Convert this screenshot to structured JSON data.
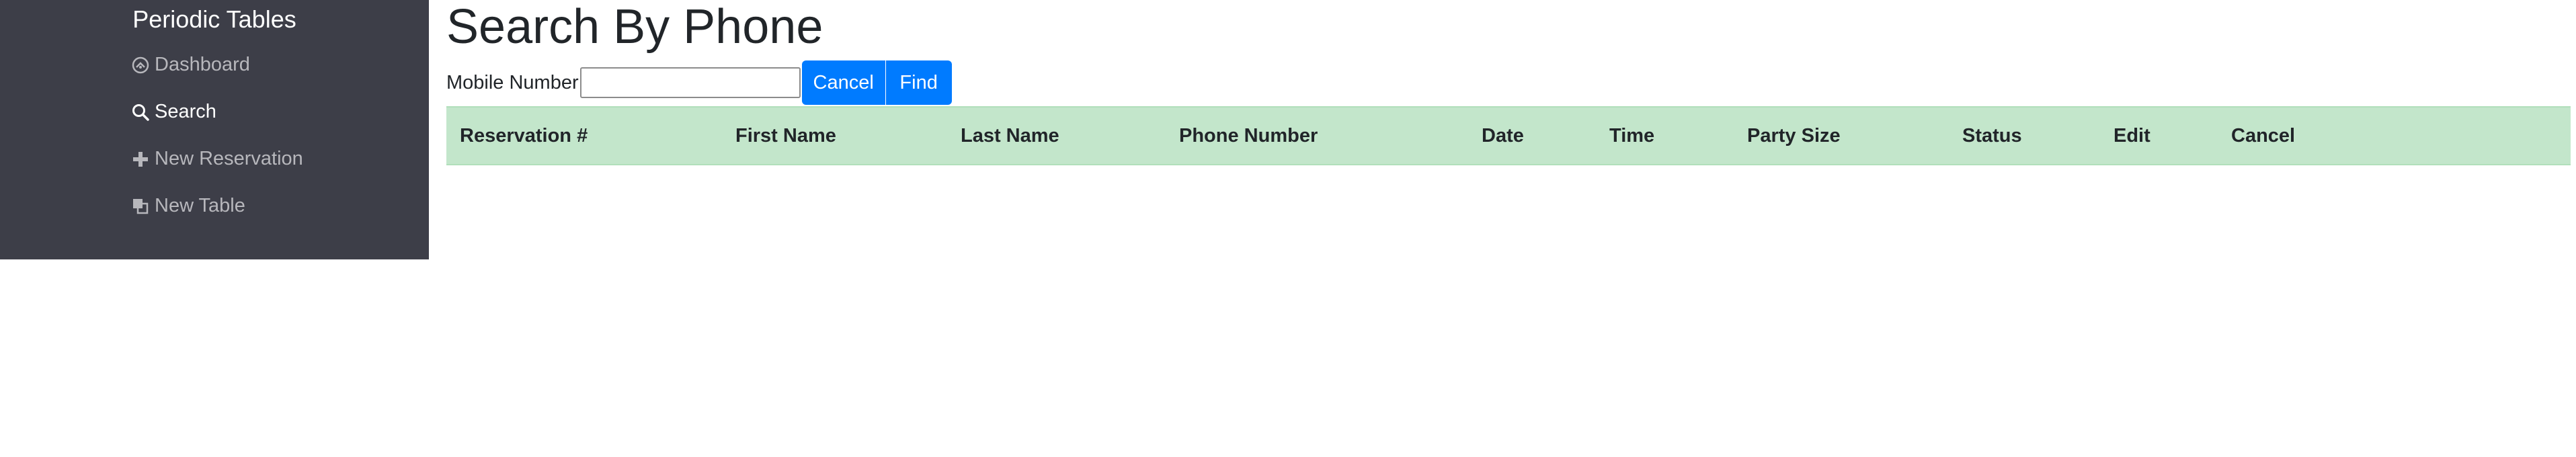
{
  "sidebar": {
    "brand": "Periodic Tables",
    "items": [
      {
        "label": "Dashboard",
        "icon": "dashboard-icon",
        "active": false
      },
      {
        "label": "Search",
        "icon": "search-icon",
        "active": true
      },
      {
        "label": "New Reservation",
        "icon": "plus-icon",
        "active": false
      },
      {
        "label": "New Table",
        "icon": "table-icon",
        "active": false
      }
    ]
  },
  "main": {
    "title": "Search By Phone",
    "form": {
      "label": "Mobile Number",
      "input_value": "",
      "placeholder": "",
      "cancel_label": "Cancel",
      "find_label": "Find"
    },
    "table": {
      "columns": [
        "Reservation #",
        "First Name",
        "Last Name",
        "Phone Number",
        "Date",
        "Time",
        "Party Size",
        "Status",
        "Edit",
        "Cancel"
      ],
      "rows": []
    }
  },
  "colors": {
    "sidebar_bg": "#3d3e48",
    "primary": "#007bff",
    "table_header_bg": "#c3e6cb"
  }
}
